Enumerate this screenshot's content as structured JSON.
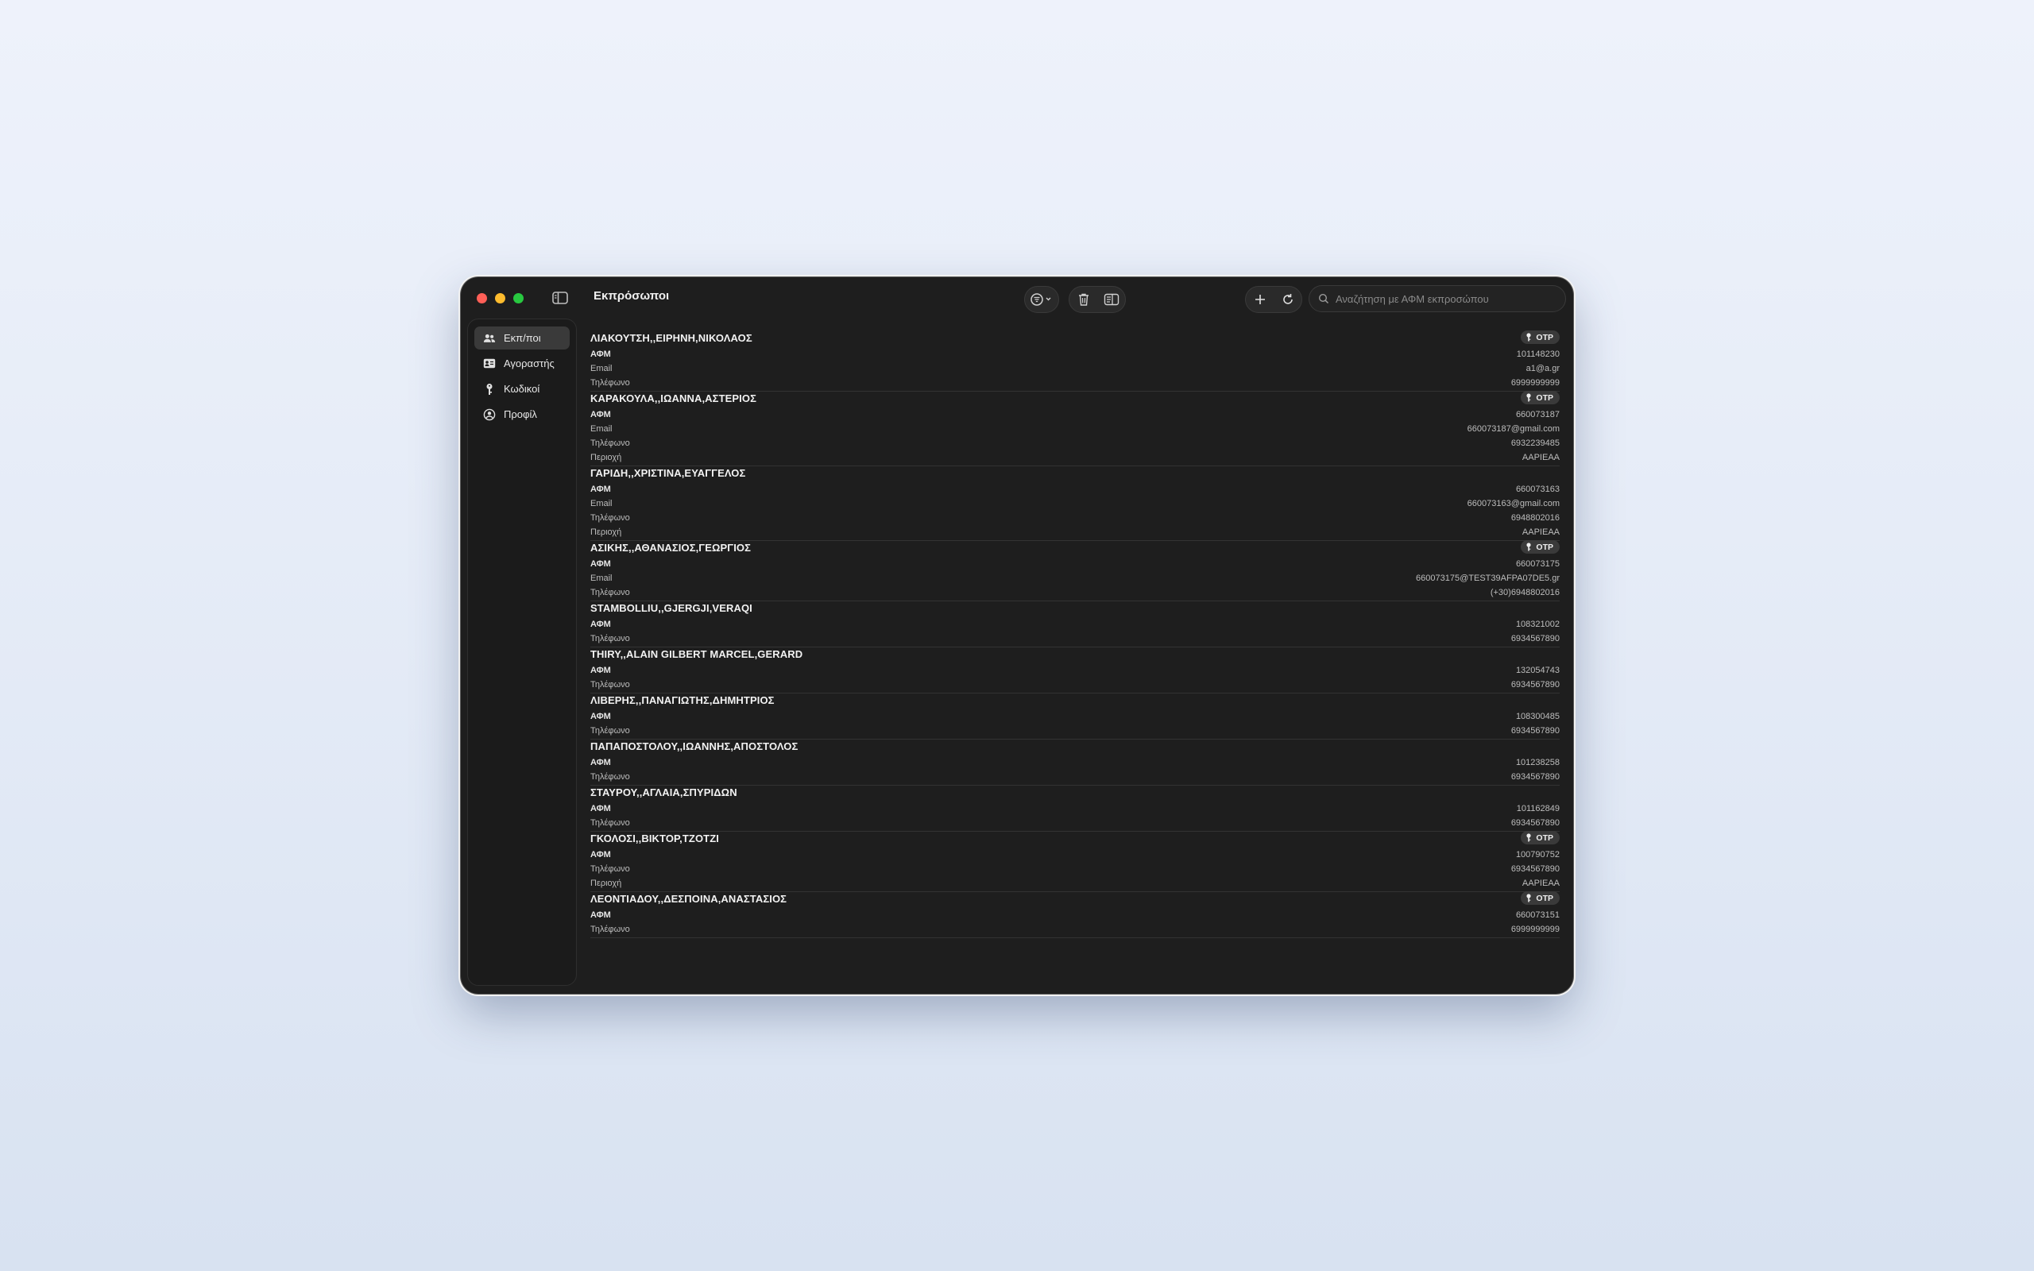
{
  "window": {
    "title": "Εκπρόσωποι"
  },
  "search": {
    "placeholder": "Αναζήτηση με ΑΦΜ εκπροσώπου"
  },
  "sidebar": {
    "items": [
      {
        "label": "Εκπ/ποι",
        "icon": "people-icon",
        "active": true
      },
      {
        "label": "Αγοραστής",
        "icon": "id-card-icon",
        "active": false
      },
      {
        "label": "Κωδικοί",
        "icon": "key-icon",
        "active": false
      },
      {
        "label": "Προφίλ",
        "icon": "person-circle-icon",
        "active": false
      }
    ]
  },
  "otp_label": "OTP",
  "labels": {
    "afm": "ΑΦΜ",
    "email": "Email",
    "phone": "Τηλέφωνο",
    "region": "Περιοχή"
  },
  "rows": [
    {
      "name": "ΛΙΑΚΟΥΤΣΗ,,ΕΙΡΗΝΗ,ΝΙΚΟΛΑΟΣ",
      "otp": true,
      "afm": "101148230",
      "email": "a1@a.gr",
      "phone": "6999999999"
    },
    {
      "name": "ΚΑΡΑΚΟΥΛΑ,,ΙΩΑΝΝΑ,ΑΣΤΕΡΙΟΣ",
      "otp": true,
      "afm": "660073187",
      "email": "660073187@gmail.com",
      "phone": "6932239485",
      "region": "AAPIEAA"
    },
    {
      "name": "ΓΑΡΙΔΗ,,ΧΡΙΣΤΙΝΑ,ΕΥΑΓΓΕΛΟΣ",
      "otp": false,
      "afm": "660073163",
      "email": "660073163@gmail.com",
      "phone": "6948802016",
      "region": "AAPIEAA"
    },
    {
      "name": "ΑΣΙΚΗΣ,,ΑΘΑΝΑΣΙΟΣ,ΓΕΩΡΓΙΟΣ",
      "otp": true,
      "afm": "660073175",
      "email": "660073175@TEST39AFPA07DE5.gr",
      "phone": "(+30)6948802016"
    },
    {
      "name": "STAMBOLLIU,,GJERGJI,VERAQI",
      "otp": false,
      "afm": "108321002",
      "phone": "6934567890"
    },
    {
      "name": "THIRY,,ALAIN GILBERT MARCEL,GERARD",
      "otp": false,
      "afm": "132054743",
      "phone": "6934567890"
    },
    {
      "name": "ΛΙΒΕΡΗΣ,,ΠΑΝΑΓΙΩΤΗΣ,ΔΗΜΗΤΡΙΟΣ",
      "otp": false,
      "afm": "108300485",
      "phone": "6934567890"
    },
    {
      "name": "ΠΑΠΑΠΟΣΤΟΛΟΥ,,ΙΩΑΝΝΗΣ,ΑΠΟΣΤΟΛΟΣ",
      "otp": false,
      "afm": "101238258",
      "phone": "6934567890"
    },
    {
      "name": "ΣΤΑΥΡΟΥ,,ΑΓΛΑΙΑ,ΣΠΥΡΙΔΩΝ",
      "otp": false,
      "afm": "101162849",
      "phone": "6934567890"
    },
    {
      "name": "ΓΚΟΛΟΣΙ,,ΒΙΚΤΟΡ,ΤΖΟΤΖΙ",
      "otp": true,
      "afm": "100790752",
      "phone": "6934567890",
      "region": "AAPIEAA"
    },
    {
      "name": "ΛΕΟΝΤΙΑΔΟΥ,,ΔΕΣΠΟΙΝΑ,ΑΝΑΣΤΑΣΙΟΣ",
      "otp": true,
      "afm": "660073151",
      "phone": "6999999999"
    }
  ]
}
